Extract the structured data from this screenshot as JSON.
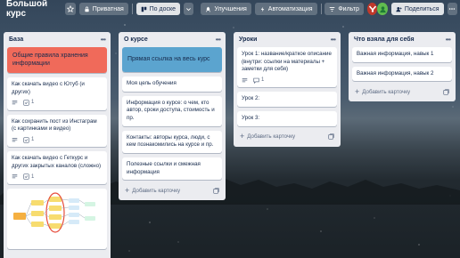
{
  "board": {
    "title": "Большой курс",
    "visibility": "Приватная",
    "view": "По доске",
    "improvements": "Улучшения",
    "automation": "Автоматизация",
    "filter": "Фильтр",
    "share": "Поделиться"
  },
  "icons": {
    "star": "star-icon",
    "lock": "lock-icon",
    "board": "board-icon",
    "chevron": "chevron-down-icon",
    "rocket": "rocket-icon",
    "bolt": "bolt-icon",
    "filter": "filter-icon",
    "share": "person-add-icon",
    "more": "more-icon",
    "description": "description-icon",
    "checklist": "checklist-icon",
    "comment": "comment-icon",
    "template": "template-icon",
    "plus": "plus-icon"
  },
  "colors": {
    "red_label": "#f06a5a",
    "blue_label": "#5ba4cf",
    "list_bg": "#ebecf0"
  },
  "lists": [
    {
      "title": "База",
      "cards": [
        {
          "text": "Общие правила хранения информации",
          "cover": "red"
        },
        {
          "text": "Как скачать видео с Ютуб (и других)",
          "checklist": "1"
        },
        {
          "text": "Как сохранить пост из Инстаграм (с картинками и видео)",
          "checklist": "1"
        },
        {
          "text": "Как скачать видео с Геткурс и других закрытых каналов (сложно)",
          "checklist": "1"
        }
      ]
    },
    {
      "title": "О курсе",
      "add": "Добавить карточку",
      "cards": [
        {
          "text": "Прямая ссылка на весь курс",
          "cover": "blue"
        },
        {
          "text": "Моя цель обучения"
        },
        {
          "text": "Информация о курсе: о чем, кто автор, сроки доступа, стоимость и пр."
        },
        {
          "text": "Контакты: авторы курса, люди, с кем познакомились на курсе и пр."
        },
        {
          "text": "Полезные ссылки и смежная информация"
        }
      ]
    },
    {
      "title": "Уроки",
      "add": "Добавить карточку",
      "cards": [
        {
          "text": "Урок 1: название/краткое описание (внутри: ссылки на материалы + заметки для себя)",
          "comments": "1"
        },
        {
          "text": "Урок 2:"
        },
        {
          "text": "Урок 3:"
        }
      ]
    },
    {
      "title": "Что взяла для себя",
      "add": "Добавить карточку",
      "cards": [
        {
          "text": "Важная информация, навык 1"
        },
        {
          "text": "Важная информация, навык 2"
        }
      ]
    }
  ]
}
